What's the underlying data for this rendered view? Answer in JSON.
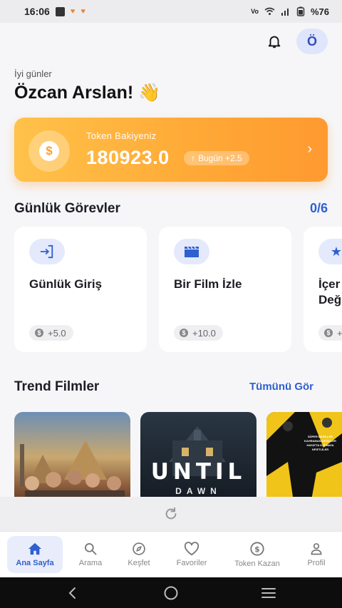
{
  "status_bar": {
    "time": "16:06",
    "battery": "%76"
  },
  "header": {
    "avatar_letter": "Ö"
  },
  "greeting": {
    "small": "İyi günler",
    "name": "Özcan Arslan! 👋"
  },
  "token_card": {
    "label": "Token Bakiyeniz",
    "value": "180923.0",
    "today_badge": "Bugün +2.5",
    "coin_symbol": "$"
  },
  "daily_tasks": {
    "title": "Günlük Görevler",
    "progress": "0/6",
    "tasks": [
      {
        "title": "Günlük Giriş",
        "reward": "+5.0",
        "icon": "login-icon"
      },
      {
        "title": "Bir Film İzle",
        "reward": "+10.0",
        "icon": "clapperboard-icon"
      },
      {
        "title_line1": "İçer",
        "title_line2": "Değ",
        "reward": "+",
        "icon": "star-icon"
      }
    ]
  },
  "trending": {
    "title": "Trend Filmler",
    "see_all": "Tümünü Gör",
    "posters": [
      {
        "caption": ""
      },
      {
        "caption_big": "UNTIL",
        "caption_small": "DAWN"
      },
      {
        "caption_lines": [
          "SÜPER DEĞİLLER",
          "KAHRAMAN DEĞİLLER",
          "HAYATTA KALMAYA",
          "NİYETLİLER"
        ]
      }
    ]
  },
  "bottom_nav": {
    "items": [
      {
        "label": "Ana Sayfa",
        "icon": "home-icon",
        "active": true
      },
      {
        "label": "Arama",
        "icon": "search-icon",
        "active": false
      },
      {
        "label": "Keşfet",
        "icon": "compass-icon",
        "active": false
      },
      {
        "label": "Favoriler",
        "icon": "heart-icon",
        "active": false
      },
      {
        "label": "Token Kazan",
        "icon": "coin-icon",
        "active": false
      },
      {
        "label": "Profil",
        "icon": "person-icon",
        "active": false
      }
    ]
  },
  "colors": {
    "accent": "#2f5fd0",
    "token_gradient_start": "#ffc24a",
    "token_gradient_end": "#ff9a30"
  }
}
